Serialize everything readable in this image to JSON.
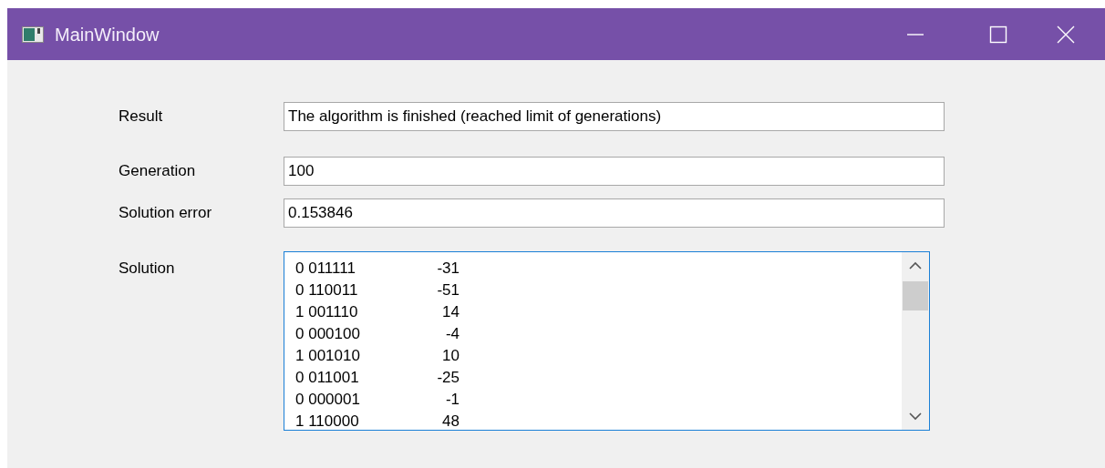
{
  "window": {
    "title": "MainWindow"
  },
  "fields": [
    {
      "label": "Result",
      "value": "The algorithm is finished (reached limit of generations)"
    },
    {
      "label": "Generation",
      "value": "100"
    },
    {
      "label": "Solution error",
      "value": "0.153846"
    }
  ],
  "solution": {
    "label": "Solution",
    "rows": [
      {
        "bits": "0 011111",
        "value": "-31"
      },
      {
        "bits": "0 110011",
        "value": "-51"
      },
      {
        "bits": "1 001110",
        "value": "14"
      },
      {
        "bits": "0 000100",
        "value": "-4"
      },
      {
        "bits": "1 001010",
        "value": "10"
      },
      {
        "bits": "0 011001",
        "value": "-25"
      },
      {
        "bits": "0 000001",
        "value": "-1"
      },
      {
        "bits": "1 110000",
        "value": "48"
      }
    ]
  }
}
